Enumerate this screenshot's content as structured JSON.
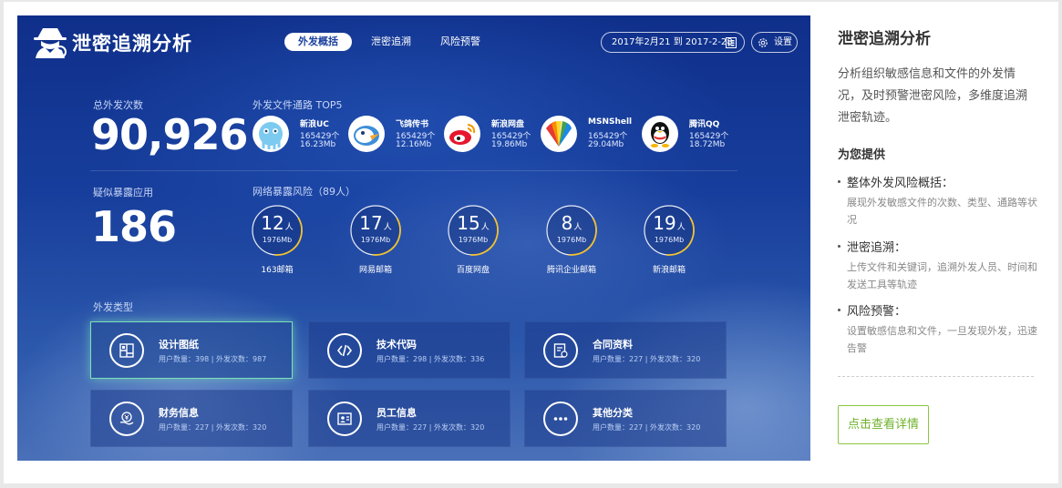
{
  "header": {
    "app_title": "泄密追溯分析",
    "tabs": [
      {
        "label": "外发概括",
        "active": true
      },
      {
        "label": "泄密追溯",
        "active": false
      },
      {
        "label": "风险预警",
        "active": false
      }
    ],
    "date_range": "2017年2月21 到 2017-2-28",
    "settings_label": "设置"
  },
  "summary": {
    "total_label": "总外发次数",
    "total_value": "90,926",
    "suspect_label": "疑似暴露应用",
    "suspect_value": "186"
  },
  "channels": {
    "label": "外发文件通路 TOP5",
    "items": [
      {
        "name": "新浪UC",
        "count": "165429个",
        "size": "16.23Mb"
      },
      {
        "name": "飞鸽传书",
        "count": "165429个",
        "size": "12.16Mb"
      },
      {
        "name": "新浪网盘",
        "count": "165429个",
        "size": "19.86Mb"
      },
      {
        "name": "MSNShell",
        "count": "165429个",
        "size": "29.04Mb"
      },
      {
        "name": "腾讯QQ",
        "count": "165429个",
        "size": "18.72Mb"
      }
    ]
  },
  "network_risk": {
    "label": "网络暴露风险（89人）",
    "unit": "人",
    "items": [
      {
        "count": "12",
        "size": "1976Mb",
        "name": "163邮箱",
        "fraction": 0.35
      },
      {
        "count": "17",
        "size": "1976Mb",
        "name": "网易邮箱",
        "fraction": 0.35
      },
      {
        "count": "15",
        "size": "1976Mb",
        "name": "百度网盘",
        "fraction": 0.35
      },
      {
        "count": "8",
        "size": "1976Mb",
        "name": "腾讯企业邮箱",
        "fraction": 0.35
      },
      {
        "count": "19",
        "size": "1976Mb",
        "name": "新浪邮箱",
        "fraction": 0.35
      }
    ]
  },
  "types": {
    "label": "外发类型",
    "items": [
      {
        "title": "设计图纸",
        "stats": "用户数量：398  |  外发次数：987",
        "active": true,
        "icon": "blueprint-icon"
      },
      {
        "title": "技术代码",
        "stats": "用户数量：298  |  外发次数：336",
        "active": false,
        "icon": "code-icon"
      },
      {
        "title": "合同资料",
        "stats": "用户数量：227  |  外发次数：320",
        "active": false,
        "icon": "contract-icon"
      },
      {
        "title": "财务信息",
        "stats": "用户数量：227  |  外发次数：320",
        "active": false,
        "icon": "finance-icon"
      },
      {
        "title": "员工信息",
        "stats": "用户数量：227  |  外发次数：320",
        "active": false,
        "icon": "id-card-icon"
      },
      {
        "title": "其他分类",
        "stats": "用户数量：227  |  外发次数：320",
        "active": false,
        "icon": "more-icon"
      }
    ]
  },
  "side": {
    "title": "泄密追溯分析",
    "description": "分析组织敏感信息和文件的外发情况，及时预警泄密风险，多维度追溯泄密轨迹。",
    "provide_title": "为您提供",
    "items": [
      {
        "title": "整体外发风险概括：",
        "desc": "展现外发敏感文件的次数、类型、通路等状况"
      },
      {
        "title": "泄密追溯：",
        "desc": "上传文件和关键词，追溯外发人员、时间和发送工具等轨迹"
      },
      {
        "title": "风险预警：",
        "desc": "设置敏感信息和文件，一旦发现外发，迅速告警"
      }
    ],
    "button_label": "点击查看详情"
  },
  "colors": {
    "accent_green": "#8cc63f",
    "ring_gold": "#f2c230",
    "active_card_glow": "#7fe0b8",
    "dashboard_blue": "#173e9c"
  }
}
